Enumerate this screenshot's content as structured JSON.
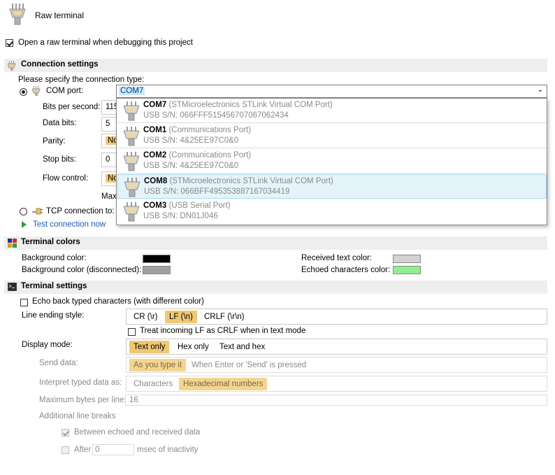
{
  "header": {
    "title": "Raw terminal",
    "icon": "serial-connector-icon"
  },
  "open_raw_terminal": {
    "label": "Open a raw terminal when debugging this project",
    "checked": true
  },
  "connection": {
    "section_title": "Connection settings",
    "prompt": "Please specify the connection type:",
    "com_port_label": "COM port:",
    "com_port_value": "COM7",
    "bits_per_second_label": "Bits per second:",
    "bits_per_second_value": "115",
    "data_bits_label": "Data bits:",
    "data_bits_value": "5",
    "parity_label": "Parity:",
    "parity_value": "No",
    "stop_bits_label": "Stop bits:",
    "stop_bits_value": "0",
    "flow_control_label": "Flow control:",
    "flow_control_value": "No",
    "max_label": "Max",
    "tcp_label": "TCP connection to:",
    "test_connection": "Test connection now",
    "dropdown": [
      {
        "port": "COM7",
        "desc": "(STMicroelectronics STLink Virtual COM Port)",
        "sn": "USB S/N: 066FFF515456707067062434"
      },
      {
        "port": "COM1",
        "desc": "(Communications Port)",
        "sn": "USB S/N: 4&25EE97C0&0"
      },
      {
        "port": "COM2",
        "desc": "(Communications Port)",
        "sn": "USB S/N: 4&25EE97C0&0"
      },
      {
        "port": "COM8",
        "desc": "(STMicroelectronics STLink Virtual COM Port)",
        "sn": "USB S/N: 066BFF495353887167034419"
      },
      {
        "port": "COM3",
        "desc": "(USB Serial Port)",
        "sn": "USB S/N: DN01J046"
      }
    ]
  },
  "colors": {
    "section_title": "Terminal colors",
    "background_label": "Background color:",
    "background_value": "#000000",
    "background_disconnected_label": "Background color (disconnected):",
    "background_disconnected_value": "#a0a0a0",
    "received_label": "Received text color:",
    "received_value": "#d3d3d3",
    "echoed_label": "Echoed characters color:",
    "echoed_value": "#90ee90"
  },
  "terminal": {
    "section_title": "Terminal settings",
    "echo_label": "Echo back typed characters (with different color)",
    "line_ending_label": "Line ending style:",
    "line_ending_options": [
      "CR (\\r)",
      "LF (\\n)",
      "CRLF (\\r\\n)"
    ],
    "line_ending_selected": "LF (\\n)",
    "treat_lf_label": "Treat incoming LF as CRLF when in text mode",
    "display_mode_label": "Display mode:",
    "display_mode_options": [
      "Text only",
      "Hex only",
      "Text and hex"
    ],
    "display_mode_selected": "Text only",
    "send_data_label": "Send data:",
    "send_data_options": [
      "As you type it",
      "When Enter or 'Send' is pressed"
    ],
    "interpret_label": "Interpret typed data as:",
    "interpret_options": [
      "Characters",
      "Hexadecimal numbers"
    ],
    "max_bytes_label": "Maximum bytes per line:",
    "max_bytes_value": "16",
    "additional_breaks_label": "Additional line breaks",
    "between_label": "Between echoed and received data",
    "after_label": "After",
    "after_value": "0",
    "after_suffix": "msec of inactivity"
  }
}
